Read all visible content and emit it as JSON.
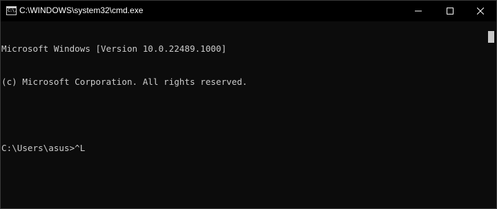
{
  "window": {
    "title": "C:\\WINDOWS\\system32\\cmd.exe",
    "icon_glyph": "C:\\."
  },
  "caption_buttons": {
    "minimize_icon": "minimize-icon",
    "maximize_icon": "maximize-icon",
    "close_icon": "close-icon"
  },
  "console": {
    "lines": [
      "Microsoft Windows [Version 10.0.22489.1000]",
      "(c) Microsoft Corporation. All rights reserved.",
      "",
      "C:\\Users\\asus>^L"
    ]
  },
  "colors": {
    "background": "#0c0c0c",
    "foreground": "#cccccc",
    "titlebar": "#000000"
  }
}
